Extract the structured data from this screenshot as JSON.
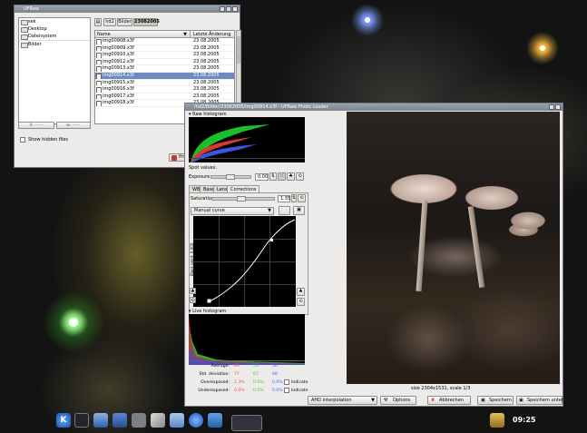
{
  "colors": {
    "accent": "#6c8cbf",
    "red": "#ff4a4a",
    "green": "#3ad43a",
    "blue": "#4a6bff",
    "titlebar": "#8a929c"
  },
  "file_browser": {
    "title": "UFRaw",
    "tree": [
      "sek",
      "Desktop",
      "Dateisystem",
      "Bilder"
    ],
    "crumbs": [
      "hd2",
      "Bilder",
      "23082005"
    ],
    "col_name": "Name",
    "col_date": "Letzte Änderung",
    "files": [
      {
        "name": "img00908.x3f",
        "date": "23.08.2005"
      },
      {
        "name": "img00909.x3f",
        "date": "23.08.2005"
      },
      {
        "name": "img00910.x3f",
        "date": "23.08.2005"
      },
      {
        "name": "img00912.x3f",
        "date": "23.08.2005"
      },
      {
        "name": "img00913.x3f",
        "date": "23.08.2005"
      },
      {
        "name": "img00914.x3f",
        "date": "23.08.2005"
      },
      {
        "name": "img00915.x3f",
        "date": "23.08.2005"
      },
      {
        "name": "img00916.x3f",
        "date": "23.08.2005"
      },
      {
        "name": "img00917.x3f",
        "date": "23.08.2005"
      },
      {
        "name": "img00918.x3f",
        "date": "23.08.2005"
      }
    ],
    "selected_index": 5,
    "show_hidden": "Show hidden files",
    "open_label": "ffnen"
  },
  "ufraw": {
    "title": "/hd2/Bilder/23082005/img00914.x3f - UFRaw Photo Loader",
    "raw_histogram": "Raw histogram",
    "spot_values": "Spot values:",
    "exposure_label": "Exposure",
    "exposure_value": "0.00",
    "tabs": [
      "WB",
      "Base",
      "Lens",
      "Corrections"
    ],
    "active_tab": 3,
    "saturation_label": "Saturation",
    "saturation_value": "1.35",
    "curve_select": "Manual curve",
    "black_point": "Black point: 0.000",
    "live_histogram": "Live histogram",
    "stats": {
      "rows": [
        {
          "label": "Average:",
          "r": "89",
          "g": "53",
          "b": "56"
        },
        {
          "label": "Std. deviation:",
          "r": "77",
          "g": "67",
          "b": "68"
        },
        {
          "label": "Overexposed:",
          "r": "1.3%",
          "g": "0.0%",
          "b": "0.0%",
          "indicate": "Indicate"
        },
        {
          "label": "Underexposed:",
          "r": "0.0%",
          "g": "0.0%",
          "b": "0.0%",
          "indicate": "Indicate"
        }
      ]
    },
    "image_size": "size 2304x1531, scale 1/3",
    "interpolation": "AHD interpolation",
    "options_button": "Options",
    "cancel_button": "Abbrechen",
    "save_button": "Speichern",
    "save_as_button": "Speichern unter"
  },
  "taskbar": {
    "clock": "09:25"
  }
}
